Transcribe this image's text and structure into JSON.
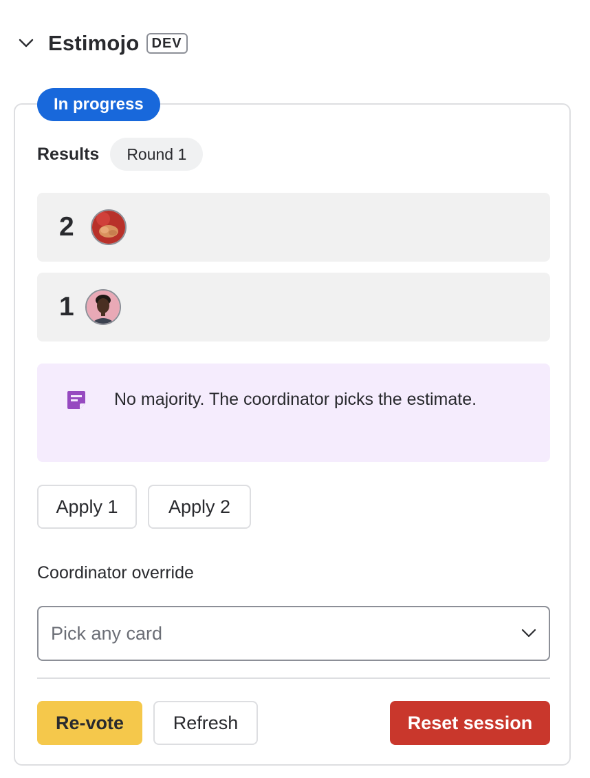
{
  "header": {
    "title": "Estimojo",
    "badge": "DEV"
  },
  "status": {
    "label": "In progress",
    "color": "#1868db"
  },
  "results": {
    "label": "Results",
    "round": "Round 1",
    "votes": [
      {
        "value": "2",
        "avatar": "voter-avatar-red-background"
      },
      {
        "value": "1",
        "avatar": "voter-avatar-pink-background"
      }
    ]
  },
  "notice": {
    "icon": "note-icon",
    "text": "No majority. The coordinator picks the estimate."
  },
  "apply_buttons": [
    "Apply 1",
    "Apply 2"
  ],
  "override": {
    "label": "Coordinator override",
    "placeholder": "Pick any card"
  },
  "actions": {
    "revote": "Re-vote",
    "refresh": "Refresh",
    "reset": "Reset session"
  },
  "colors": {
    "revote": "#f5c84b",
    "reset": "#c9372c",
    "notice_bg": "#f5ecfd",
    "notice_icon": "#964ac0"
  }
}
